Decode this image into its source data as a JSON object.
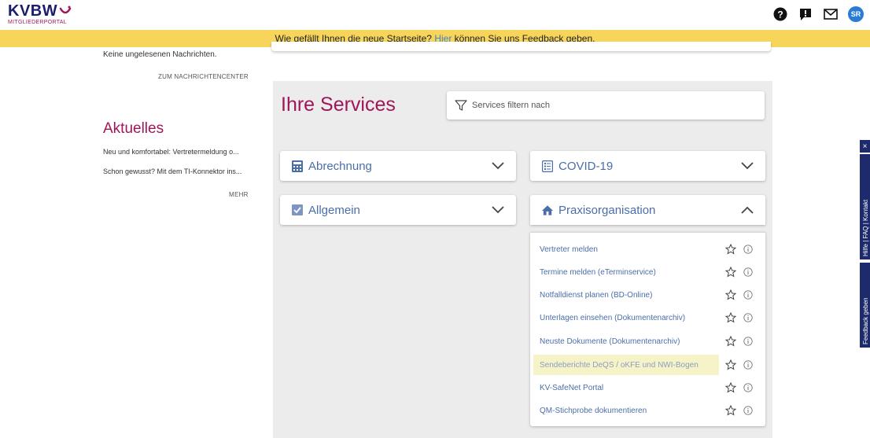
{
  "header": {
    "logo_text": "KVBW",
    "logo_subtext": "MITGLIEDERPORTAL",
    "avatar_initials": "SR",
    "icons": [
      "help-icon",
      "alert-icon",
      "mail-icon",
      "avatar"
    ]
  },
  "banner": {
    "text_before": "Wie gefällt Ihnen die neue Startseite? ",
    "link": "Hier",
    "text_after": " können Sie uns Feedback geben."
  },
  "messages": {
    "status": "Keine ungelesenen Nachrichten.",
    "link": "ZUM NACHRICHTENCENTER"
  },
  "news": {
    "title": "Aktuelles",
    "items": [
      "Neu und komfortabel: Vertretermeldung o...",
      "Schon gewusst? Mit dem TI-Konnektor ins..."
    ],
    "more": "MEHR"
  },
  "services": {
    "title": "Ihre Services",
    "filter_placeholder": "Services filtern nach",
    "categories": [
      {
        "label": "Abrechnung",
        "icon": "calculator-icon",
        "expanded": false
      },
      {
        "label": "COVID-19",
        "icon": "list-icon",
        "expanded": false
      },
      {
        "label": "Allgemein",
        "icon": "checkbox-icon",
        "expanded": false
      },
      {
        "label": "Praxisorganisation",
        "icon": "home-icon",
        "expanded": true
      }
    ],
    "items": [
      "Vertreter melden",
      "Termine melden (eTerminservice)",
      "Notfalldienst planen (BD-Online)",
      "Unterlagen einsehen (Dokumentenarchiv)",
      "Neuste Dokumente (Dokumentenarchiv)",
      "Sendeberichte DeQS / oKFE und NWI-Bogen",
      "KV-SafeNet Portal",
      "QM-Stichprobe dokumentieren"
    ]
  },
  "side": {
    "close": "×",
    "help": "Hilfe | FAQ | Kontakt",
    "feedback": "Feedback geben"
  },
  "colors": {
    "brand_navy": "#1d1d6e",
    "brand_magenta": "#a0165a",
    "banner_yellow": "#f7d55a",
    "link_blue": "#4a6ea8"
  }
}
